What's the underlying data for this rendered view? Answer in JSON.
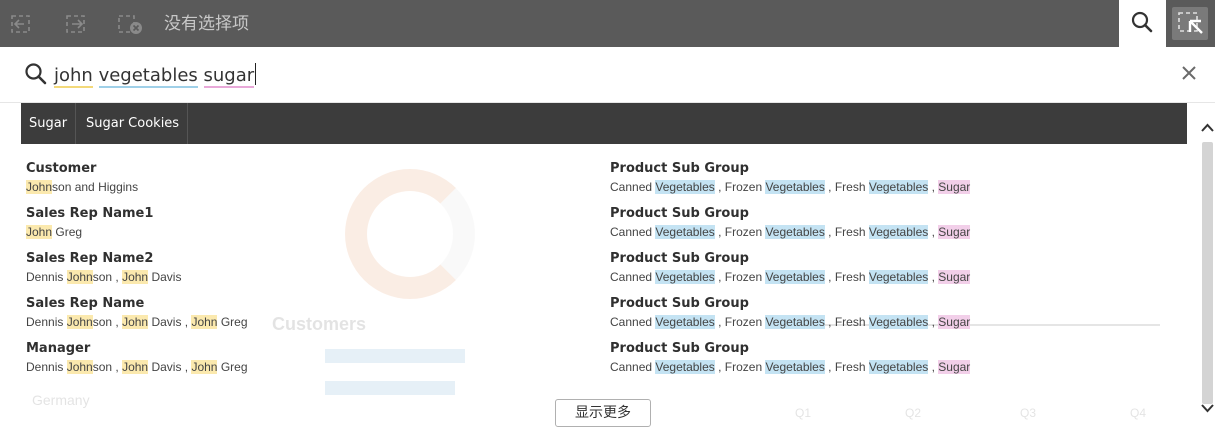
{
  "toolbar": {
    "selection_status": "没有选择项",
    "icons": [
      "step-back-icon",
      "step-forward-icon",
      "clear-selections-icon",
      "search-icon",
      "lasso-select-icon"
    ]
  },
  "search": {
    "query_words": [
      "john",
      "vegetables",
      "sugar"
    ],
    "close_icon": "close-icon"
  },
  "suggestions": [
    "Sugar",
    "Sugar Cookies"
  ],
  "colors": {
    "toolbar_bg": "#5a5a5a",
    "chip_bar_bg": "#3c3c3c",
    "highlight_john": "#fbe9ae",
    "highlight_vegetables": "#c4e3f3",
    "highlight_sugar": "#f2cfe9"
  },
  "results_left": [
    {
      "field": "Customer",
      "segments": [
        {
          "t": "John",
          "hl": "y"
        },
        {
          "t": "son and Higgins"
        }
      ]
    },
    {
      "field": "Sales Rep Name1",
      "segments": [
        {
          "t": "John",
          "hl": "y"
        },
        {
          "t": " Greg"
        }
      ]
    },
    {
      "field": "Sales Rep Name2",
      "segments": [
        {
          "t": "Dennis "
        },
        {
          "t": "John",
          "hl": "y"
        },
        {
          "t": "son , "
        },
        {
          "t": "John",
          "hl": "y"
        },
        {
          "t": " Davis"
        }
      ]
    },
    {
      "field": "Sales Rep Name",
      "segments": [
        {
          "t": "Dennis "
        },
        {
          "t": "John",
          "hl": "y"
        },
        {
          "t": "son , "
        },
        {
          "t": "John",
          "hl": "y"
        },
        {
          "t": " Davis , "
        },
        {
          "t": "John",
          "hl": "y"
        },
        {
          "t": " Greg"
        }
      ]
    },
    {
      "field": "Manager",
      "segments": [
        {
          "t": "Dennis "
        },
        {
          "t": "John",
          "hl": "y"
        },
        {
          "t": "son , "
        },
        {
          "t": "John",
          "hl": "y"
        },
        {
          "t": " Davis , "
        },
        {
          "t": "John",
          "hl": "y"
        },
        {
          "t": " Greg"
        }
      ]
    }
  ],
  "results_right": [
    {
      "field": "Product Sub Group",
      "segments": [
        {
          "t": "Canned "
        },
        {
          "t": "Vegetables",
          "hl": "b"
        },
        {
          "t": " , Frozen "
        },
        {
          "t": "Vegetables",
          "hl": "b"
        },
        {
          "t": " , Fresh "
        },
        {
          "t": "Vegetables",
          "hl": "b"
        },
        {
          "t": " , "
        },
        {
          "t": "Sugar",
          "hl": "p"
        }
      ]
    },
    {
      "field": "Product Sub Group",
      "segments": [
        {
          "t": "Canned "
        },
        {
          "t": "Vegetables",
          "hl": "b"
        },
        {
          "t": " , Frozen "
        },
        {
          "t": "Vegetables",
          "hl": "b"
        },
        {
          "t": " , Fresh "
        },
        {
          "t": "Vegetables",
          "hl": "b"
        },
        {
          "t": " , "
        },
        {
          "t": "Sugar",
          "hl": "p"
        }
      ]
    },
    {
      "field": "Product Sub Group",
      "segments": [
        {
          "t": "Canned "
        },
        {
          "t": "Vegetables",
          "hl": "b"
        },
        {
          "t": " , Frozen "
        },
        {
          "t": "Vegetables",
          "hl": "b"
        },
        {
          "t": " , Fresh "
        },
        {
          "t": "Vegetables",
          "hl": "b"
        },
        {
          "t": " , "
        },
        {
          "t": "Sugar",
          "hl": "p"
        }
      ]
    },
    {
      "field": "Product Sub Group",
      "segments": [
        {
          "t": "Canned "
        },
        {
          "t": "Vegetables",
          "hl": "b"
        },
        {
          "t": " , Frozen "
        },
        {
          "t": "Vegetables",
          "hl": "b"
        },
        {
          "t": " , Fresh "
        },
        {
          "t": "Vegetables",
          "hl": "b"
        },
        {
          "t": " , "
        },
        {
          "t": "Sugar",
          "hl": "p"
        }
      ]
    },
    {
      "field": "Product Sub Group",
      "segments": [
        {
          "t": "Canned "
        },
        {
          "t": "Vegetables",
          "hl": "b"
        },
        {
          "t": " , Frozen "
        },
        {
          "t": "Vegetables",
          "hl": "b"
        },
        {
          "t": " , Fresh "
        },
        {
          "t": "Vegetables",
          "hl": "b"
        },
        {
          "t": " , "
        },
        {
          "t": "Sugar",
          "hl": "p"
        }
      ]
    }
  ],
  "background": {
    "title": "Customers",
    "country": "Germany",
    "quarters": [
      "Q1",
      "Q2",
      "Q3",
      "Q4"
    ]
  },
  "show_more_label": "显示更多"
}
